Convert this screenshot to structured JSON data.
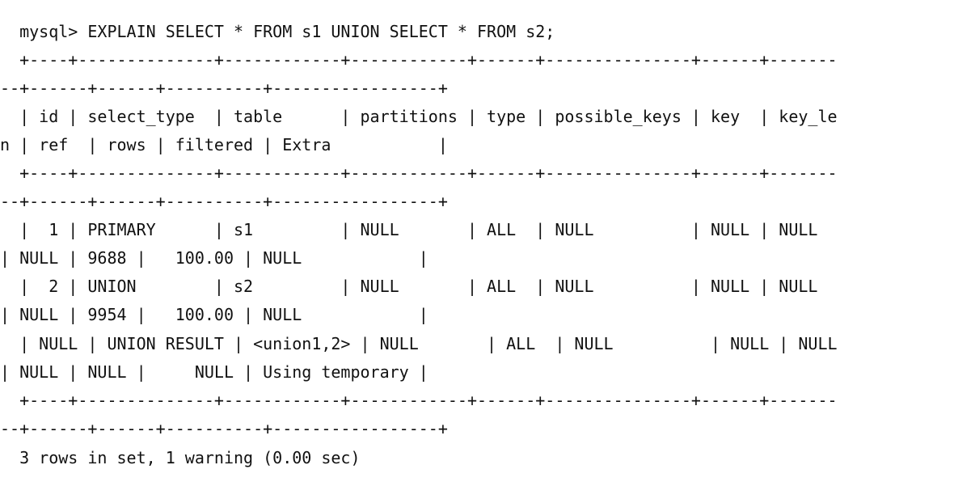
{
  "terminal": {
    "lines": [
      "  mysql> EXPLAIN SELECT * FROM s1 UNION SELECT * FROM s2;",
      "  +----+--------------+------------+------------+------+---------------+------+-------",
      "--+------+------+----------+-----------------+",
      "  | id | select_type  | table      | partitions | type | possible_keys | key  | key_le",
      "n | ref  | rows | filtered | Extra           |",
      "  +----+--------------+------------+------------+------+---------------+------+-------",
      "--+------+------+----------+-----------------+",
      "  |  1 | PRIMARY      | s1         | NULL       | ALL  | NULL          | NULL | NULL",
      "| NULL | 9688 |   100.00 | NULL            |",
      "  |  2 | UNION        | s2         | NULL       | ALL  | NULL          | NULL | NULL",
      "| NULL | 9954 |   100.00 | NULL            |",
      "  | NULL | UNION RESULT | <union1,2> | NULL       | ALL  | NULL          | NULL | NULL",
      "| NULL | NULL |     NULL | Using temporary |",
      "  +----+--------------+------------+------------+------+---------------+------+-------",
      "--+------+------+----------+-----------------+",
      "  3 rows in set, 1 warning (0.00 sec)"
    ]
  }
}
